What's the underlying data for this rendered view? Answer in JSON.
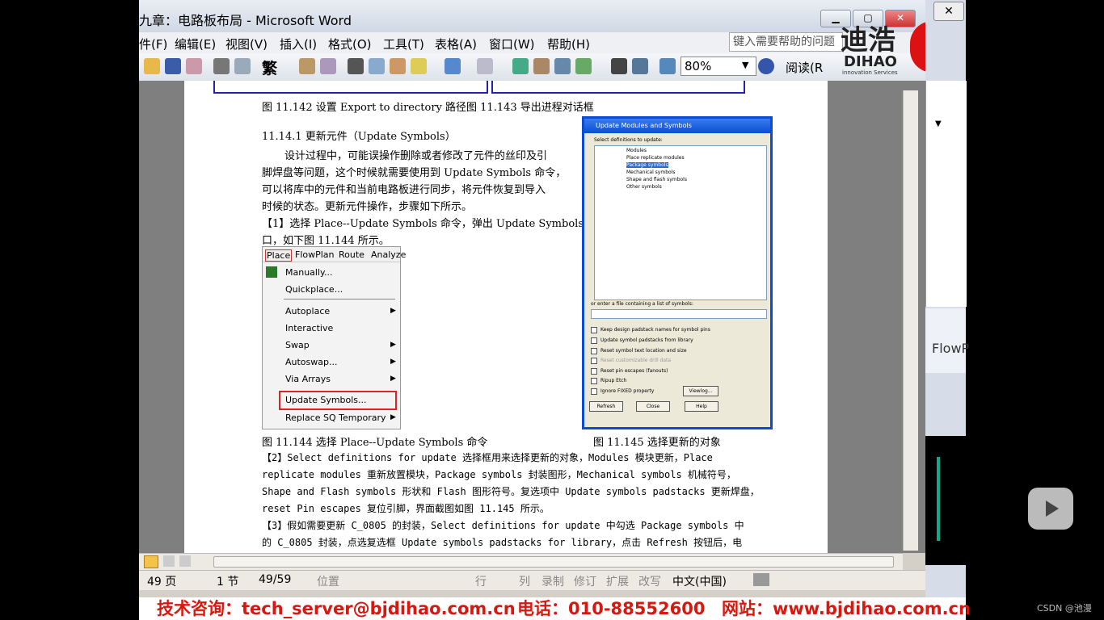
{
  "window": {
    "title": "九章：电路板布局 - Microsoft Word",
    "close_glyph": "✕",
    "min_glyph": "▁",
    "max_glyph": "▢"
  },
  "outer_close_glyph": "✕",
  "menu": [
    "件(F)",
    "编辑(E)",
    "视图(V)",
    "插入(I)",
    "格式(O)",
    "工具(T)",
    "表格(A)",
    "窗口(W)",
    "帮助(H)"
  ],
  "help_search": "键入需要帮助的问题",
  "toolbar": {
    "zoom": "80%",
    "read_label": "阅读(R",
    "font_label": "繁"
  },
  "logo": {
    "cn": "迪浩",
    "en": "DIHAO",
    "tagline": "innovation Services"
  },
  "doc": {
    "fig_caption_top": "图 11.142  设置 Export to directory 路径图          11.143  导出进程对话框",
    "section_heading": "11.14.1 更新元件（Update Symbols）",
    "para1": [
      "设计过程中，可能误操作删除或者修改了元件的丝印及引",
      "脚焊盘等问题，这个时候就需要使用到 Update Symbols 命令，",
      "可以将库中的元件和当前电路板进行同步，将元件恢复到导入",
      "时候的状态。更新元件操作，步骤如下所示。"
    ],
    "step1": [
      "【1】选择 Place--Update Symbols 命令，弹出 Update Symbols 窗",
      "口，如下图 11.144 所示。"
    ],
    "fig144": "图 11.144 选择 Place--Update Symbols 命令",
    "fig145": "图 11.145 选择更新的对象",
    "step2": [
      "【2】Select definitions for update 选择框用来选择更新的对象，Modules 模块更新，Place",
      "replicate modules 重新放置模块，Package symbols 封装图形，Mechanical symbols 机械符号，",
      "Shape and Flash symbols 形状和 Flash 图形符号。复选项中 Update symbols padstacks 更新焊盘，",
      "reset Pin escapes 复位引脚，界面截图如图 11.145 所示。"
    ],
    "step3": [
      "【3】假如需要更新 C_0805 的封装，Select definitions for update 中勾选 Package symbols 中",
      "的 C_0805 封装，点选复选框 Update symbols padstacks for library，点击 Refresh 按钮后，电"
    ]
  },
  "place_menu": {
    "bar": [
      "Place",
      "FlowPlan",
      "Route",
      "Analyze"
    ],
    "items": [
      "Manually...",
      "Quickplace...",
      "Autoplace",
      "Interactive",
      "Swap",
      "Autoswap...",
      "Via Arrays",
      "Update Symbols...",
      "Replace SQ Temporary"
    ]
  },
  "dialog": {
    "title": "Update Modules and Symbols",
    "select_label": "Select definitions to update:",
    "tree": [
      "Modules",
      "Place replicate modules",
      "Package symbols",
      "Mechanical symbols",
      "Shape and flash symbols",
      "Other symbols"
    ],
    "file_label": "or enter a file containing a list of symbols:",
    "options": [
      "Keep design padstack names for symbol pins",
      "Update symbol padstacks from library",
      "Reset symbol text location and size",
      "Reset customizable drill data",
      "Reset pin escapes (fanouts)",
      "Ripup Etch",
      "Ignore FIXED property"
    ],
    "buttons": [
      "Viewlog...",
      "Refresh",
      "Close",
      "Help"
    ]
  },
  "status": {
    "page": "49 页",
    "section": "1 节",
    "pages": "49/59",
    "position": "位置",
    "line": "行",
    "col": "列",
    "rec": "录制",
    "trk": "修订",
    "ext": "扩展",
    "ovr": "改写",
    "lang": "中文(中国)"
  },
  "right_app": {
    "label": "FlowP"
  },
  "footer": {
    "consult": "技术咨询：tech_server@bjdihao.com.cn",
    "phone": "电话：010-88552600",
    "site": "网站：www.bjdihao.com.cn"
  },
  "watermark": "CSDN @池漫"
}
